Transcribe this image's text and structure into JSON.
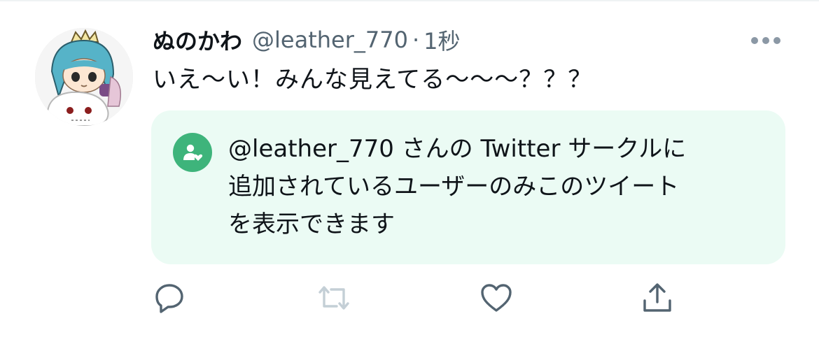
{
  "tweet": {
    "author": {
      "display_name": "ぬのかわ",
      "handle": "@leather_770"
    },
    "separator": "·",
    "timestamp": "1秒",
    "text": "いえ〜い！みんな見えてる〜〜〜？？？",
    "circle_notice": {
      "line1": "@leather_770 さんの Twitter サークルに",
      "line2": "追加されているユーザーのみこのツイート",
      "line3": "を表示できます"
    }
  },
  "icons": {
    "more": "more-dots-icon",
    "circle": "twitter-circle-icon",
    "reply": "reply-icon",
    "retweet": "retweet-icon",
    "like": "heart-icon",
    "share": "share-icon"
  },
  "colors": {
    "text_primary": "#0f1419",
    "text_secondary": "#536471",
    "circle_background": "#ebfbf4",
    "circle_accent": "#3eb47b",
    "icon_default": "#536471",
    "icon_disabled": "#c4cfd6"
  }
}
